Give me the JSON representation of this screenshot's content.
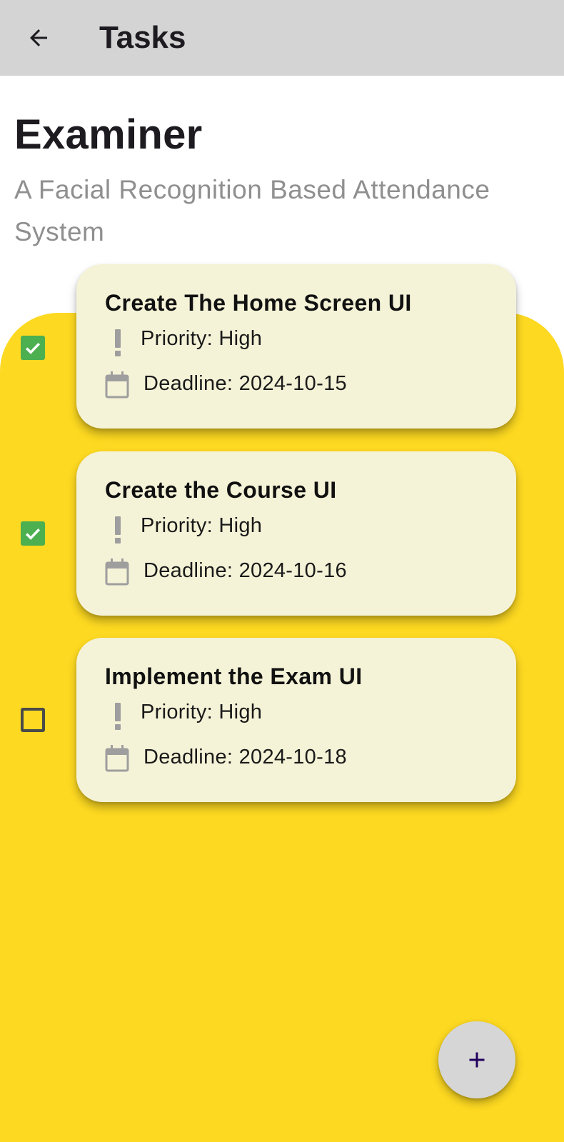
{
  "app_bar": {
    "title": "Tasks",
    "back_icon": "arrow-back-icon"
  },
  "project": {
    "title": "Examiner",
    "subtitle": "A Facial Recognition Based Attendance System"
  },
  "tasks": [
    {
      "title": "Create The Home Screen UI",
      "priority": "Priority: High",
      "deadline": "Deadline: 2024-10-15",
      "completed": true
    },
    {
      "title": "Create the Course UI",
      "priority": "Priority: High",
      "deadline": "Deadline: 2024-10-16",
      "completed": true
    },
    {
      "title": "Implement the Exam UI",
      "priority": "Priority: High",
      "deadline": "Deadline: 2024-10-18",
      "completed": false
    }
  ],
  "fab": {
    "icon": "add-icon"
  },
  "colors": {
    "app_bar": "#d4d4d4",
    "panel": "#fdd921",
    "card": "#f5f3d7",
    "checkbox_checked": "#4caf50",
    "subtitle": "#8f8f8f",
    "fab": "#d6d6d6",
    "fab_icon": "#21005d"
  }
}
